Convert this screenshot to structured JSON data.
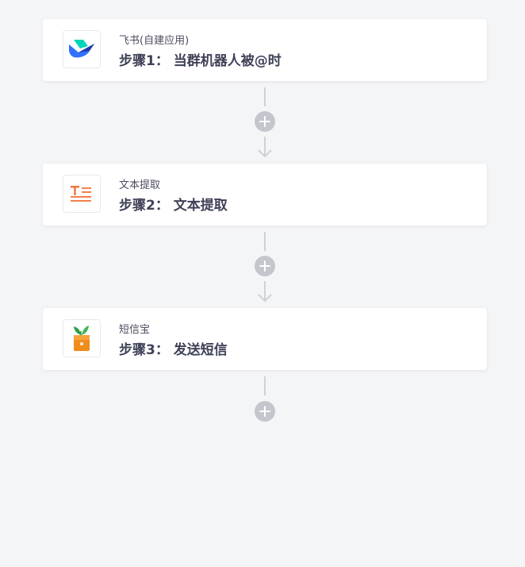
{
  "steps": [
    {
      "app_name": "飞书(自建应用)",
      "title": "步骤1： 当群机器人被@时",
      "icon": "feishu-logo-icon"
    },
    {
      "app_name": "文本提取",
      "title": "步骤2： 文本提取",
      "icon": "text-extract-icon"
    },
    {
      "app_name": "短信宝",
      "title": "步骤3： 发送短信",
      "icon": "sms-bao-icon"
    }
  ],
  "connector_icons": {
    "add": "plus-circle-icon",
    "arrow": "arrow-down-icon"
  },
  "colors": {
    "background": "#f4f5f7",
    "card": "#ffffff",
    "title_text": "#3f4257",
    "connector": "#cfd1d8",
    "add_button": "#c4c6cd",
    "text_extract_orange": "#f0743a",
    "sms_orange": "#f08c1c",
    "feishu_blue": "#3370ff",
    "feishu_teal": "#00d6b9"
  }
}
